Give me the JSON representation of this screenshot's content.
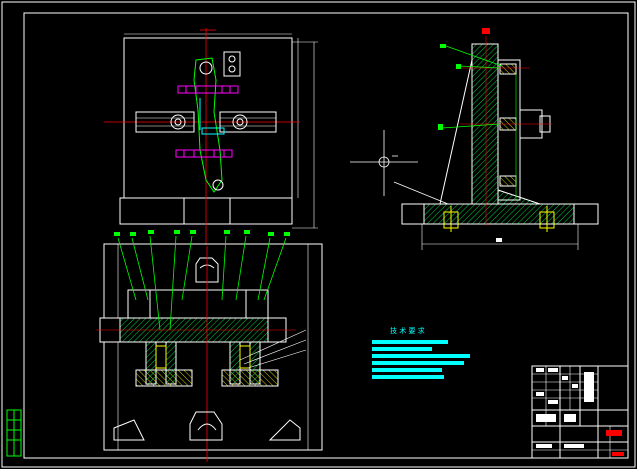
{
  "drawing": {
    "colors": {
      "background": "#000000",
      "outline": "#ffffff",
      "centerline": "#ff0000",
      "hatch": "#00cc44",
      "cyan": "#00ffff",
      "magenta": "#ff00ff",
      "yellow": "#ffff00",
      "leader": "#00ff00"
    },
    "views": [
      "top-view",
      "front-section-view",
      "side-section-view"
    ],
    "tech_requirements": {
      "heading": "技 术 要 求"
    },
    "title_block": {
      "present": true
    }
  }
}
